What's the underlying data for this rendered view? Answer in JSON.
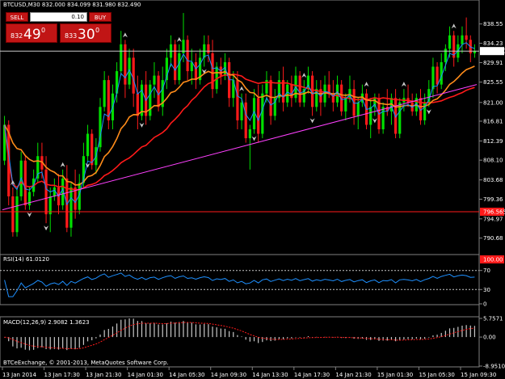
{
  "window": {
    "symbol_header": "BTCUSD,M30  832.000 834.099 831.980 832.490",
    "copyright": "BTCeExchange, © 2001-2013, MetaQuotes Software Corp."
  },
  "trade_panel": {
    "sell_label": "SELL",
    "buy_label": "BUY",
    "lot_value": "0.10",
    "sell_price_small": "832",
    "sell_price_big": "49",
    "sell_price_sup": "0",
    "buy_price_small": "833",
    "buy_price_big": "30",
    "buy_price_sup": "0"
  },
  "colors": {
    "bull": "#00e000",
    "bear": "#ff1a1a",
    "ma_fast": "#1e90ff",
    "ma_mid": "#ff8c1a",
    "ma_slow": "#ff1a1a",
    "trendline": "#ff40ff",
    "level_line": "#ff1a1a",
    "current_price_line": "#c8c8c8",
    "rsi_line": "#1e90ff",
    "macd_bars": "#c8c8c8",
    "macd_signal": "#ff1a1a",
    "price_box": "#ff1a1a"
  },
  "chart_data": [
    {
      "type": "candlestick",
      "title": "BTCUSD,M30  832.000 834.099 831.980 832.490",
      "y_ticks": [
        "838.55",
        "834.23",
        "829.91",
        "825.55",
        "821.00",
        "816.81",
        "812.39",
        "808.10",
        "803.68",
        "799.36",
        "794.97",
        "790.68"
      ],
      "ylim": [
        788.8,
        842.1
      ],
      "x_ticks": [
        "13 Jan 2014",
        "13 Jan 17:30",
        "13 Jan 21:30",
        "14 Jan 01:30",
        "14 Jan 05:30",
        "14 Jan 09:30",
        "14 Jan 13:30",
        "14 Jan 17:30",
        "14 Jan 21:30",
        "15 Jan 01:30",
        "15 Jan 05:30",
        "15 Jan 09:30"
      ],
      "current_price_label": "832.490",
      "current_price": 832.49,
      "level_price_label": "796.565",
      "level_price": 796.565,
      "trendline": {
        "from": [
          0,
          797.0
        ],
        "to": [
          123,
          825.0
        ]
      },
      "candles": [
        [
          808,
          818,
          807,
          816
        ],
        [
          816,
          817,
          798,
          800
        ],
        [
          800,
          802,
          791,
          792
        ],
        [
          792,
          802,
          791,
          800
        ],
        [
          800,
          810,
          799,
          808
        ],
        [
          808,
          809,
          797,
          798
        ],
        [
          798,
          802,
          797,
          801
        ],
        [
          801,
          806,
          800,
          804
        ],
        [
          804,
          812,
          803,
          809
        ],
        [
          809,
          812,
          804,
          806
        ],
        [
          806,
          809,
          794,
          796
        ],
        [
          796,
          802,
          792,
          800
        ],
        [
          800,
          804,
          799,
          802
        ],
        [
          802,
          805,
          796,
          798
        ],
        [
          798,
          806,
          797,
          804
        ],
        [
          804,
          807,
          792,
          793
        ],
        [
          793,
          803,
          791,
          802
        ],
        [
          802,
          806,
          795,
          797
        ],
        [
          797,
          805,
          796,
          803
        ],
        [
          803,
          812,
          802,
          809
        ],
        [
          809,
          816,
          808,
          814
        ],
        [
          814,
          815,
          806,
          807
        ],
        [
          807,
          813,
          805,
          811
        ],
        [
          811,
          822,
          810,
          820
        ],
        [
          820,
          828,
          819,
          826
        ],
        [
          826,
          827,
          815,
          817
        ],
        [
          817,
          825,
          815,
          823
        ],
        [
          823,
          830,
          821,
          828
        ],
        [
          828,
          837,
          827,
          834
        ],
        [
          834,
          835,
          822,
          825
        ],
        [
          825,
          833,
          824,
          831
        ],
        [
          831,
          833,
          820,
          823
        ],
        [
          823,
          827,
          815,
          818
        ],
        [
          818,
          826,
          817,
          825
        ],
        [
          825,
          828,
          816,
          818
        ],
        [
          818,
          826,
          817,
          825
        ],
        [
          825,
          830,
          822,
          827
        ],
        [
          827,
          828,
          819,
          820
        ],
        [
          820,
          829,
          818,
          826
        ],
        [
          826,
          833,
          824,
          831
        ],
        [
          831,
          836,
          829,
          834
        ],
        [
          834,
          835,
          825,
          826
        ],
        [
          826,
          834,
          825,
          832
        ],
        [
          832,
          841,
          830,
          835
        ],
        [
          835,
          836,
          826,
          828
        ],
        [
          828,
          833,
          825,
          830
        ],
        [
          830,
          832,
          824,
          826
        ],
        [
          826,
          833,
          825,
          831
        ],
        [
          831,
          836,
          829,
          834
        ],
        [
          834,
          836,
          830,
          832
        ],
        [
          832,
          835,
          822,
          824
        ],
        [
          824,
          830,
          823,
          829
        ],
        [
          829,
          831,
          825,
          827
        ],
        [
          827,
          832,
          826,
          830
        ],
        [
          830,
          831,
          820,
          822
        ],
        [
          822,
          828,
          820,
          826
        ],
        [
          826,
          828,
          815,
          817
        ],
        [
          817,
          823,
          815,
          821
        ],
        [
          821,
          823,
          812,
          813
        ],
        [
          813,
          816,
          806,
          815
        ],
        [
          815,
          824,
          814,
          822
        ],
        [
          822,
          825,
          812,
          814
        ],
        [
          814,
          825,
          813,
          823
        ],
        [
          823,
          828,
          821,
          826
        ],
        [
          826,
          827,
          816,
          818
        ],
        [
          818,
          824,
          817,
          822
        ],
        [
          822,
          828,
          821,
          826
        ],
        [
          826,
          829,
          819,
          821
        ],
        [
          821,
          826,
          820,
          825
        ],
        [
          825,
          827,
          820,
          822
        ],
        [
          822,
          829,
          821,
          827
        ],
        [
          827,
          828,
          820,
          821
        ],
        [
          821,
          826,
          820,
          824
        ],
        [
          824,
          829,
          823,
          827
        ],
        [
          827,
          828,
          818,
          820
        ],
        [
          820,
          826,
          819,
          824
        ],
        [
          824,
          826,
          818,
          821
        ],
        [
          821,
          827,
          820,
          825
        ],
        [
          825,
          828,
          822,
          823
        ],
        [
          823,
          826,
          819,
          821
        ],
        [
          821,
          827,
          820,
          825
        ],
        [
          825,
          826,
          818,
          819
        ],
        [
          819,
          823,
          817,
          822
        ],
        [
          822,
          827,
          821,
          824
        ],
        [
          824,
          826,
          816,
          818
        ],
        [
          818,
          822,
          815,
          821
        ],
        [
          821,
          825,
          820,
          823
        ],
        [
          823,
          824,
          815,
          816
        ],
        [
          816,
          822,
          813,
          820
        ],
        [
          820,
          823,
          818,
          822
        ],
        [
          822,
          823,
          814,
          815
        ],
        [
          815,
          821,
          814,
          820
        ],
        [
          820,
          824,
          818,
          819
        ],
        [
          819,
          823,
          816,
          822
        ],
        [
          822,
          824,
          813,
          814
        ],
        [
          814,
          822,
          813,
          821
        ],
        [
          821,
          824,
          819,
          822
        ],
        [
          822,
          825,
          820,
          821
        ],
        [
          821,
          823,
          818,
          819
        ],
        [
          819,
          823,
          818,
          822
        ],
        [
          822,
          824,
          816,
          817
        ],
        [
          817,
          823,
          816,
          821
        ],
        [
          821,
          826,
          820,
          824
        ],
        [
          824,
          831,
          822,
          829
        ],
        [
          829,
          830,
          823,
          825
        ],
        [
          825,
          832,
          824,
          830
        ],
        [
          830,
          834,
          828,
          833
        ],
        [
          833,
          838,
          831,
          836
        ],
        [
          836,
          837,
          829,
          831
        ],
        [
          831,
          836,
          830,
          834
        ],
        [
          834,
          838,
          832,
          836
        ],
        [
          836,
          840,
          833,
          835
        ],
        [
          835,
          836,
          830,
          832
        ],
        [
          832,
          834,
          831,
          832.49
        ]
      ],
      "arrows_up_index": [
        2,
        14,
        29,
        42,
        57,
        72,
        87,
        96,
        108
      ],
      "arrows_down_index": [
        6,
        10,
        20,
        33,
        48,
        60,
        74,
        89,
        102
      ]
    },
    {
      "type": "line",
      "title": "RSI(14) 61.0120",
      "y_ticks": [
        "100.00",
        "70",
        "30",
        "0"
      ],
      "ylim": [
        0,
        100
      ],
      "levels": [
        70,
        30
      ]
    },
    {
      "type": "bar",
      "title": "MACD(12,26,9) 2.9082 1.3623",
      "y_ticks": [
        "5.7571",
        "0.00",
        "-8.9510"
      ],
      "ylim": [
        -8.951,
        5.7571
      ]
    }
  ]
}
